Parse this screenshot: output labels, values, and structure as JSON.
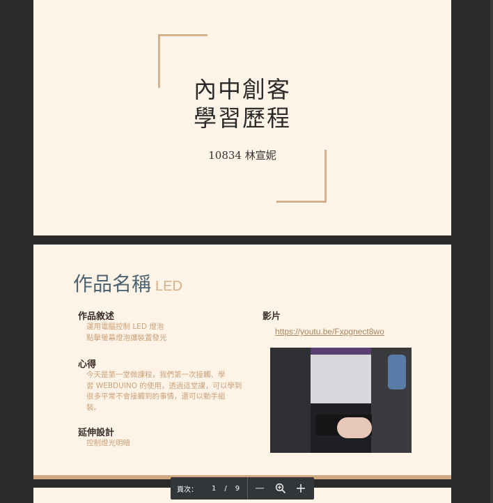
{
  "slide1": {
    "title_line1": "內中創客",
    "title_line2": "學習歷程",
    "author": "10834 林宣妮"
  },
  "slide2": {
    "title": "作品名稱",
    "title_suffix": "LED",
    "work_description": {
      "heading": "作品敘述",
      "lines": [
        "運用電腦控制 LED 燈泡",
        "點擊螢幕燈泡讓裝置發光"
      ]
    },
    "reflection": {
      "heading": "心得",
      "lines": [
        "今天是第一堂微課程，我們第一次接觸、學",
        "習 WEBDUINO 的使用，透過這堂課，可以學到",
        "很多平常不會接觸到的事情，還可以動手組",
        "裝。"
      ]
    },
    "extension": {
      "heading": "延伸設計",
      "lines": [
        "控制燈光明暗"
      ]
    },
    "video": {
      "heading": "影片",
      "link": "https://youtu.be/Fxpgnect8wo"
    }
  },
  "toolbar": {
    "page_label": "頁次：",
    "current_page": "1",
    "separator": "/",
    "total_pages": "9",
    "icons": {
      "zoom_out": "minus-icon",
      "zoom_fit": "zoom-icon",
      "zoom_in": "plus-icon"
    }
  }
}
